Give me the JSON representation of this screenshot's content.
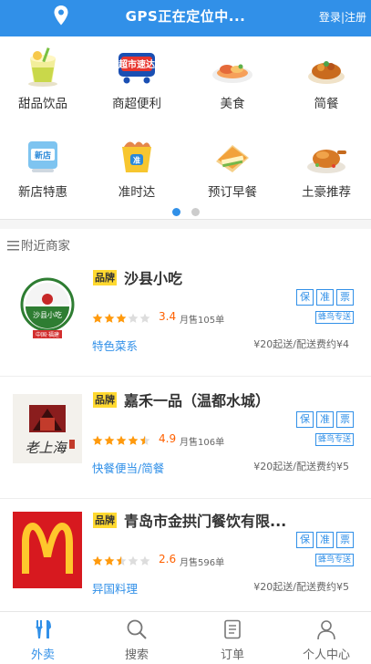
{
  "header": {
    "title": "GPS正在定位中...",
    "login": "登录",
    "separator": "|",
    "register": "注册",
    "icon": "location-pin-icon",
    "bg_color": "#3190e8"
  },
  "categories": [
    {
      "label": "甜品饮品",
      "icon": "dessert-drink-icon"
    },
    {
      "label": "商超便利",
      "icon": "supermarket-icon",
      "badge": "超市速达"
    },
    {
      "label": "美食",
      "icon": "food-plate-icon"
    },
    {
      "label": "简餐",
      "icon": "simple-meal-icon"
    },
    {
      "label": "新店特惠",
      "icon": "new-store-icon",
      "badge": "新店"
    },
    {
      "label": "准时达",
      "icon": "on-time-icon",
      "badge": "准"
    },
    {
      "label": "预订早餐",
      "icon": "breakfast-icon"
    },
    {
      "label": "土豪推荐",
      "icon": "roast-chicken-icon"
    }
  ],
  "pager": {
    "count": 2,
    "active": 0
  },
  "nearby": {
    "title": "附近商家",
    "icon": "menu-lines-icon"
  },
  "shops": [
    {
      "brand": "品牌",
      "name": "沙县小吃",
      "tags": [
        "保",
        "准",
        "票"
      ],
      "rating": "3.4",
      "stars": 3,
      "sales": "月售105单",
      "delivery": "蜂鸟专送",
      "category": "特色菜系",
      "fee": "¥20起送/配送费约¥4",
      "logo": "shaxian-logo",
      "logo_text": "沙县小吃",
      "logo_subtext": "中国·福建"
    },
    {
      "brand": "品牌",
      "name": "嘉禾一品（温都水城）",
      "tags": [
        "保",
        "准",
        "票"
      ],
      "rating": "4.9",
      "stars": 4.5,
      "sales": "月售106单",
      "delivery": "蜂鸟专送",
      "category": "快餐便当/简餐",
      "fee": "¥20起送/配送费约¥5",
      "logo": "laoshanghai-logo",
      "logo_text": "老上海"
    },
    {
      "brand": "品牌",
      "name": "青岛市金拱门餐饮有限...",
      "tags": [
        "保",
        "准",
        "票"
      ],
      "rating": "2.6",
      "stars": 2.5,
      "sales": "月售596单",
      "delivery": "蜂鸟专送",
      "category": "异国料理",
      "fee": "¥20起送/配送费约¥5",
      "logo": "mcdonalds-logo"
    }
  ],
  "tabs": [
    {
      "label": "外卖",
      "icon": "fork-knife-icon",
      "active": true
    },
    {
      "label": "搜索",
      "icon": "search-icon",
      "active": false
    },
    {
      "label": "订单",
      "icon": "order-list-icon",
      "active": false
    },
    {
      "label": "个人中心",
      "icon": "user-icon",
      "active": false
    }
  ]
}
